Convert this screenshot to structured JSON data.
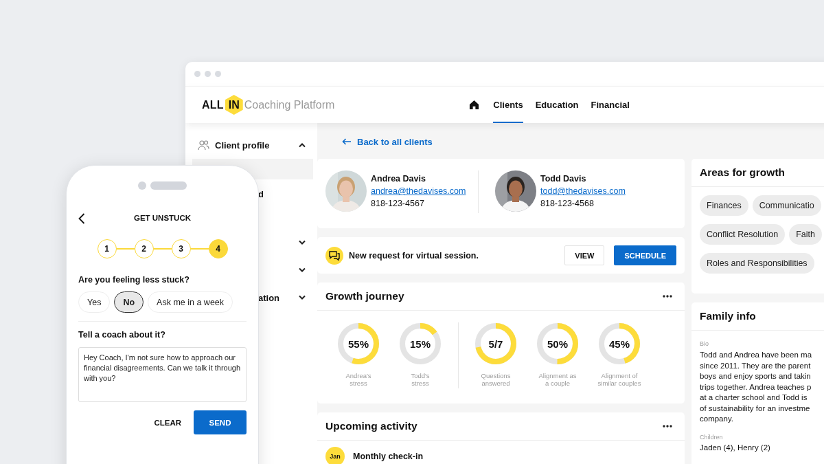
{
  "logo": {
    "word": "ALL",
    "badge": "IN",
    "subtitle": "Coaching Platform"
  },
  "nav": {
    "tabs": [
      {
        "label": "Clients",
        "selected": true
      },
      {
        "label": "Education",
        "selected": false
      },
      {
        "label": "Financial",
        "selected": false
      }
    ]
  },
  "sidebar": {
    "sections": [
      {
        "label": "Client profile",
        "expanded": true,
        "items": [
          {
            "selected": true
          },
          {
            "label": "d",
            "selected": false
          }
        ]
      },
      {
        "expanded": false
      },
      {
        "expanded": false
      },
      {
        "label": "ation",
        "expanded": false
      }
    ]
  },
  "back_link": "Back to all clients",
  "clients": [
    {
      "name": "Andrea Davis",
      "email": "andrea@thedavises.com",
      "phone": "818-123-4567"
    },
    {
      "name": "Todd Davis",
      "email": "todd@thedavises.com",
      "phone": "818-123-4568"
    }
  ],
  "notice": {
    "text": "New request for virtual session.",
    "buttons": [
      "VIEW",
      "SCHEDULE"
    ]
  },
  "growth_journey": {
    "title": "Growth journey",
    "metric_groups": [
      {
        "metrics": [
          {
            "value": "55%",
            "label": "Andrea's\nstress",
            "level": 0.55
          },
          {
            "value": "15%",
            "label": "Todd's\nstress",
            "level": 0.15
          }
        ]
      },
      {
        "metrics": [
          {
            "value": "5/7",
            "label": "Questions\nanswered",
            "level": 0.714
          },
          {
            "value": "50%",
            "label": "Alignment as\na couple",
            "level": 0.5
          },
          {
            "value": "45%",
            "label": "Alignment of\nsimilar couples",
            "level": 0.45
          }
        ]
      }
    ]
  },
  "upcoming_activity": {
    "title": "Upcoming activity",
    "items": [
      {
        "month": "Jan",
        "title": "Monthly check-in"
      }
    ]
  },
  "areas_for_growth": {
    "title": "Areas for growth",
    "tags": [
      "Finances",
      "Communicatio",
      "Conflict Resolution",
      "Faith",
      "Roles and Responsibilities"
    ]
  },
  "family_info": {
    "title": "Family info",
    "bio_label": "Bio",
    "bio_lines": [
      "Todd and Andrea have been ma",
      "since 2011. They are the parent",
      "boys and enjoy sports and takin",
      "trips together. Andrea teaches p",
      "at a charter school and Todd is",
      "of sustainability for an investme",
      "company."
    ],
    "children_label": "Children",
    "children": "Jaden (4), Henry (2)"
  },
  "phone": {
    "title": "GET UNSTUCK",
    "steps": [
      {
        "label": "1",
        "selected": false
      },
      {
        "label": "2",
        "selected": false
      },
      {
        "label": "3",
        "selected": false
      },
      {
        "label": "4",
        "selected": true
      }
    ],
    "question": "Are you feeling less stuck?",
    "options": [
      {
        "label": "Yes",
        "selected": false
      },
      {
        "label": "No",
        "selected": true
      },
      {
        "label": "Ask me in a week",
        "selected": false
      }
    ],
    "prompt": "Tell a coach about it?",
    "message": "Hey Coach, I'm not sure how to approach our financial disagreements. Can we talk it through with you?",
    "buttons": [
      "CLEAR",
      "SEND"
    ]
  }
}
